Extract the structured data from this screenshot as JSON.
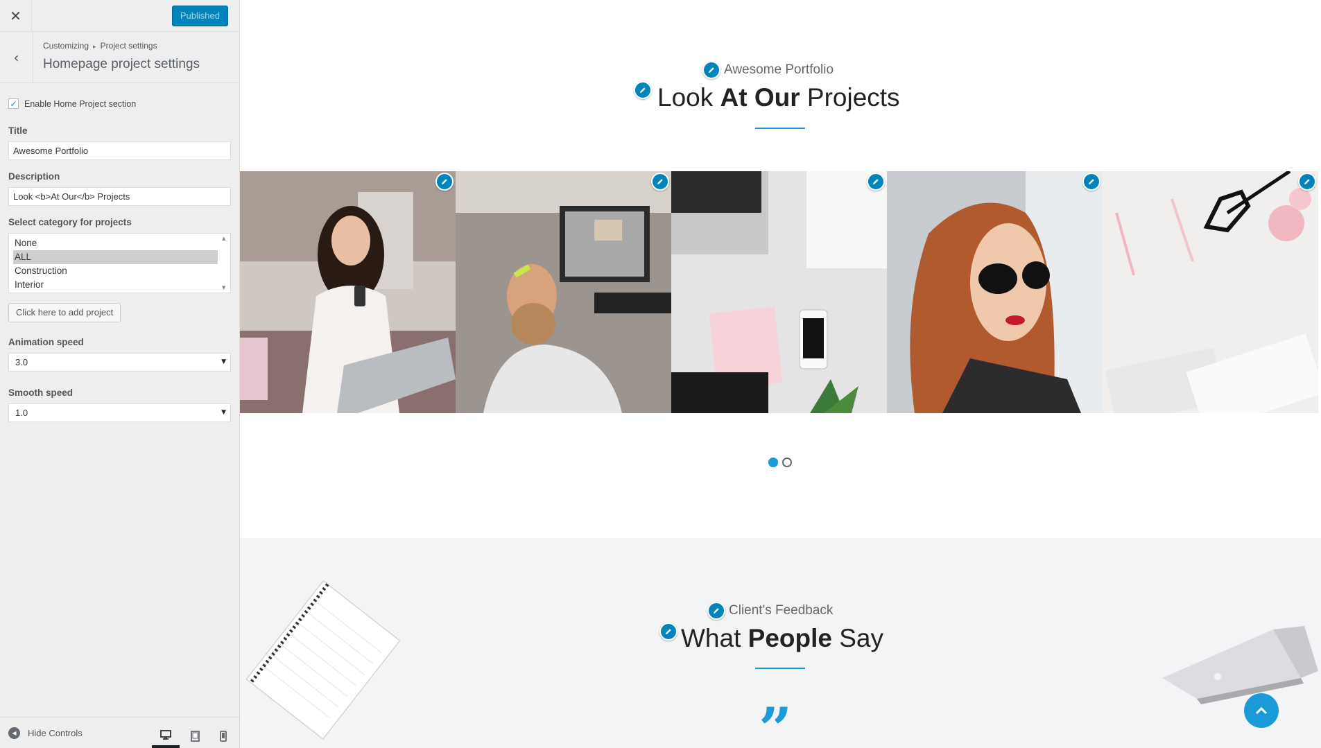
{
  "sidebar": {
    "close_glyph": "✕",
    "publish_label": "Published",
    "back_glyph": "‹",
    "breadcrumb": {
      "root": "Customizing",
      "sep": "▸",
      "parent": "Project settings"
    },
    "section_title": "Homepage project settings",
    "enable_checkbox": {
      "label": "Enable Home Project section",
      "checked": true,
      "check_glyph": "✓"
    },
    "title_field": {
      "label": "Title",
      "value": "Awesome Portfolio"
    },
    "description_field": {
      "label": "Description",
      "value": "Look <b>At Our</b> Projects"
    },
    "category": {
      "label": "Select category for projects",
      "options": [
        "None",
        "ALL",
        "Construction",
        "Interior"
      ],
      "selected": "ALL",
      "scroll_up": "▲",
      "scroll_down": "▼"
    },
    "add_project_label": "Click here to add project",
    "animation_speed": {
      "label": "Animation speed",
      "value": "3.0",
      "arrow": "▼"
    },
    "smooth_speed": {
      "label": "Smooth speed",
      "value": "1.0",
      "arrow": "▼"
    },
    "footer": {
      "hide_controls_label": "Hide Controls",
      "hide_glyph": "◀",
      "devices": [
        "desktop-icon",
        "tablet-icon",
        "mobile-icon"
      ],
      "active_device": "desktop"
    }
  },
  "preview": {
    "portfolio": {
      "subtitle": "Awesome Portfolio",
      "heading_pre": "Look ",
      "heading_bold": "At Our",
      "heading_post": " Projects"
    },
    "gallery_tiles": [
      "woman-phone-laptop",
      "bearded-man-office",
      "desk-flatlay",
      "woman-sunglasses",
      "desk-glasses-roses"
    ],
    "slider": {
      "pages": 2,
      "active_page": 1
    },
    "feedback": {
      "subtitle": "Client's Feedback",
      "heading_pre": "What ",
      "heading_bold": "People",
      "heading_post": " Say",
      "quote_glyph": "”"
    },
    "accent_color": "#1a9ad6",
    "edit_color": "#0085ba"
  }
}
